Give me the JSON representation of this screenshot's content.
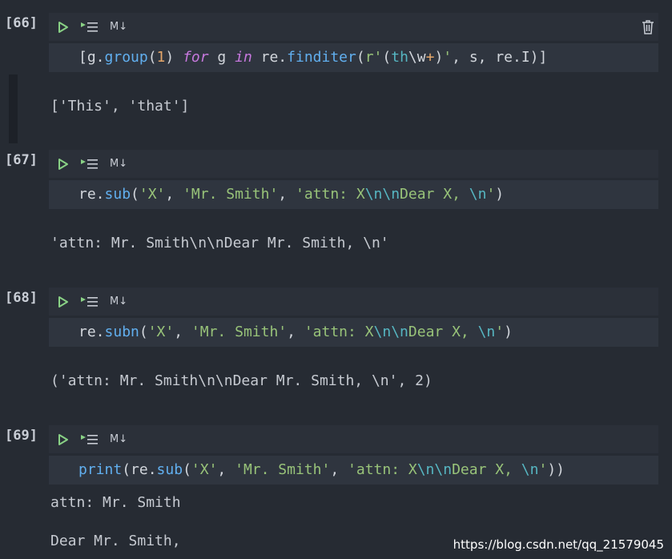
{
  "cells": [
    {
      "count": "[66]",
      "code_tokens": [
        {
          "t": "[g.",
          "c": "p"
        },
        {
          "t": "group",
          "c": "fn"
        },
        {
          "t": "(",
          "c": "p"
        },
        {
          "t": "1",
          "c": "num"
        },
        {
          "t": ") ",
          "c": "p"
        },
        {
          "t": "for",
          "c": "it"
        },
        {
          "t": " g ",
          "c": "p"
        },
        {
          "t": "in",
          "c": "it"
        },
        {
          "t": " re.",
          "c": "p"
        },
        {
          "t": "finditer",
          "c": "fn"
        },
        {
          "t": "(",
          "c": "p"
        },
        {
          "t": "r'",
          "c": "str"
        },
        {
          "t": "(",
          "c": "p"
        },
        {
          "t": "th",
          "c": "esc"
        },
        {
          "t": "\\w",
          "c": "p"
        },
        {
          "t": "+",
          "c": "num"
        },
        {
          "t": ")",
          "c": "p"
        },
        {
          "t": "'",
          "c": "str"
        },
        {
          "t": ", s, re.I)]",
          "c": "p"
        }
      ],
      "output_lines": [
        "['This', 'that']"
      ],
      "has_delete": true
    },
    {
      "count": "[67]",
      "code_tokens": [
        {
          "t": "re.",
          "c": "p"
        },
        {
          "t": "sub",
          "c": "fn"
        },
        {
          "t": "(",
          "c": "p"
        },
        {
          "t": "'X'",
          "c": "str"
        },
        {
          "t": ", ",
          "c": "p"
        },
        {
          "t": "'Mr. Smith'",
          "c": "str"
        },
        {
          "t": ", ",
          "c": "p"
        },
        {
          "t": "'attn: X",
          "c": "str"
        },
        {
          "t": "\\n\\n",
          "c": "esc"
        },
        {
          "t": "Dear X, ",
          "c": "str"
        },
        {
          "t": "\\n",
          "c": "esc"
        },
        {
          "t": "'",
          "c": "str"
        },
        {
          "t": ")",
          "c": "p"
        }
      ],
      "output_lines": [
        "'attn: Mr. Smith\\n\\nDear Mr. Smith, \\n'"
      ],
      "has_delete": false
    },
    {
      "count": "[68]",
      "code_tokens": [
        {
          "t": "re.",
          "c": "p"
        },
        {
          "t": "subn",
          "c": "fn"
        },
        {
          "t": "(",
          "c": "p"
        },
        {
          "t": "'X'",
          "c": "str"
        },
        {
          "t": ", ",
          "c": "p"
        },
        {
          "t": "'Mr. Smith'",
          "c": "str"
        },
        {
          "t": ", ",
          "c": "p"
        },
        {
          "t": "'attn: X",
          "c": "str"
        },
        {
          "t": "\\n\\n",
          "c": "esc"
        },
        {
          "t": "Dear X, ",
          "c": "str"
        },
        {
          "t": "\\n",
          "c": "esc"
        },
        {
          "t": "'",
          "c": "str"
        },
        {
          "t": ")",
          "c": "p"
        }
      ],
      "output_lines": [
        "('attn: Mr. Smith\\n\\nDear Mr. Smith, \\n', 2)"
      ],
      "has_delete": false
    },
    {
      "count": "[69]",
      "code_tokens": [
        {
          "t": "print",
          "c": "fn"
        },
        {
          "t": "(re.",
          "c": "p"
        },
        {
          "t": "sub",
          "c": "fn"
        },
        {
          "t": "(",
          "c": "p"
        },
        {
          "t": "'X'",
          "c": "str"
        },
        {
          "t": ", ",
          "c": "p"
        },
        {
          "t": "'Mr. Smith'",
          "c": "str"
        },
        {
          "t": ", ",
          "c": "p"
        },
        {
          "t": "'attn: X",
          "c": "str"
        },
        {
          "t": "\\n\\n",
          "c": "esc"
        },
        {
          "t": "Dear X, ",
          "c": "str"
        },
        {
          "t": "\\n",
          "c": "esc"
        },
        {
          "t": "'",
          "c": "str"
        },
        {
          "t": "))",
          "c": "p"
        }
      ],
      "output_lines": [
        "attn: Mr. Smith",
        "Dear Mr. Smith,"
      ],
      "has_delete": false
    }
  ],
  "toolbar": {
    "md_label": "M↓"
  },
  "watermark": "https://blog.csdn.net/qq_21579045",
  "colors": {
    "run": "#89d185",
    "fn": "#61afef",
    "str": "#98c379",
    "num": "#e5a76a",
    "kw": "#c678dd",
    "esc": "#56b6c2"
  }
}
